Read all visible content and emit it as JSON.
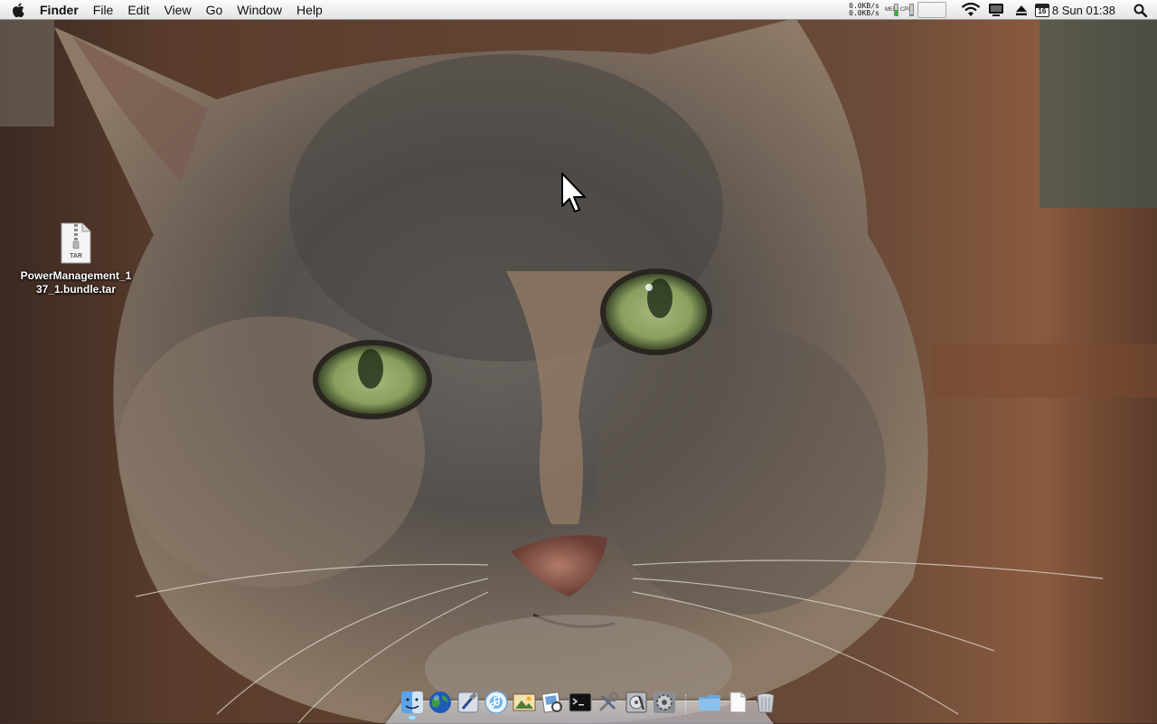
{
  "menubar": {
    "apple_icon": "apple-icon",
    "app_name": "Finder",
    "menus": [
      "File",
      "Edit",
      "View",
      "Go",
      "Window",
      "Help"
    ]
  },
  "status": {
    "net_up": "0.0KB/s",
    "net_down": "0.0KB/s",
    "mem_label": "MEM",
    "cpu_label": "CPU",
    "icons": [
      "network-monitor-icon",
      "memory-meter-icon",
      "cpu-graph-icon",
      "wifi-icon",
      "display-icon",
      "eject-icon",
      "calendar-icon",
      "spotlight-icon"
    ],
    "calendar_day": "16",
    "clock": "8 Sun 01:38"
  },
  "desktop": {
    "file": {
      "icon_badge": "TAR",
      "name_line1": "PowerManagement_1",
      "name_line2": "37_1.bundle.tar"
    }
  },
  "dock": {
    "apps": [
      "finder-icon",
      "network-globe-icon",
      "xcode-icon",
      "itunes-icon",
      "iphoto-icon",
      "preview-icon",
      "terminal-icon",
      "utilities-icon",
      "disk-utility-icon",
      "system-preferences-icon"
    ],
    "docs": [
      "folder-icon",
      "document-icon",
      "trash-icon"
    ]
  },
  "colors": {
    "menubar": "#ececec",
    "running_indicator": "#9fe1ff"
  }
}
